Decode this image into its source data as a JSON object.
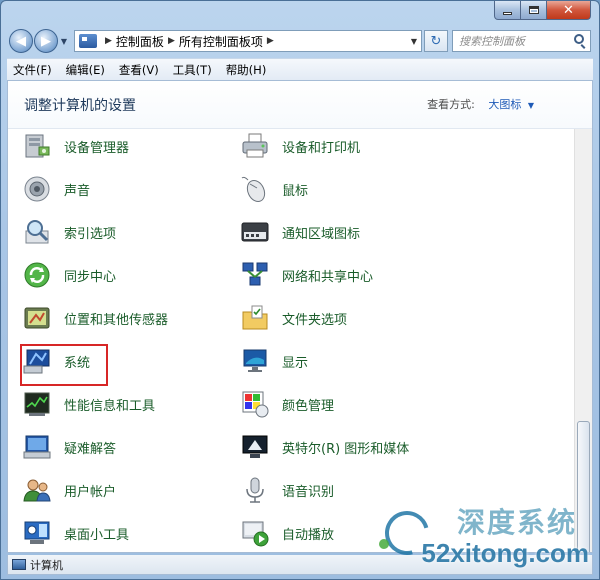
{
  "window": {
    "address": [
      "控制面板",
      "所有控制面板项"
    ],
    "search_placeholder": "搜索控制面板"
  },
  "menubar": [
    "文件(F)",
    "编辑(E)",
    "查看(V)",
    "工具(T)",
    "帮助(H)"
  ],
  "header": {
    "title": "调整计算机的设置",
    "view_by_label": "查看方式:",
    "view_by_value": "大图标"
  },
  "items": [
    {
      "label": "设备管理器",
      "icon": "device-manager-icon"
    },
    {
      "label": "设备和打印机",
      "icon": "printer-icon"
    },
    {
      "label": "声音",
      "icon": "speaker-icon"
    },
    {
      "label": "鼠标",
      "icon": "mouse-icon"
    },
    {
      "label": "索引选项",
      "icon": "index-search-icon"
    },
    {
      "label": "通知区域图标",
      "icon": "notification-area-icon"
    },
    {
      "label": "同步中心",
      "icon": "sync-center-icon"
    },
    {
      "label": "网络和共享中心",
      "icon": "network-icon"
    },
    {
      "label": "位置和其他传感器",
      "icon": "location-sensor-icon"
    },
    {
      "label": "文件夹选项",
      "icon": "folder-options-icon"
    },
    {
      "label": "系统",
      "icon": "system-icon"
    },
    {
      "label": "显示",
      "icon": "display-icon"
    },
    {
      "label": "性能信息和工具",
      "icon": "performance-icon"
    },
    {
      "label": "颜色管理",
      "icon": "color-management-icon"
    },
    {
      "label": "疑难解答",
      "icon": "troubleshooting-icon"
    },
    {
      "label": "英特尔(R) 图形和媒体",
      "icon": "intel-graphics-icon"
    },
    {
      "label": "用户帐户",
      "icon": "user-accounts-icon"
    },
    {
      "label": "语音识别",
      "icon": "microphone-icon"
    },
    {
      "label": "桌面小工具",
      "icon": "gadgets-icon"
    },
    {
      "label": "自动播放",
      "icon": "autoplay-icon"
    }
  ],
  "statusbar": {
    "text": "计算机"
  },
  "watermark": {
    "top": "深度系统",
    "main": "52xitong.com"
  }
}
